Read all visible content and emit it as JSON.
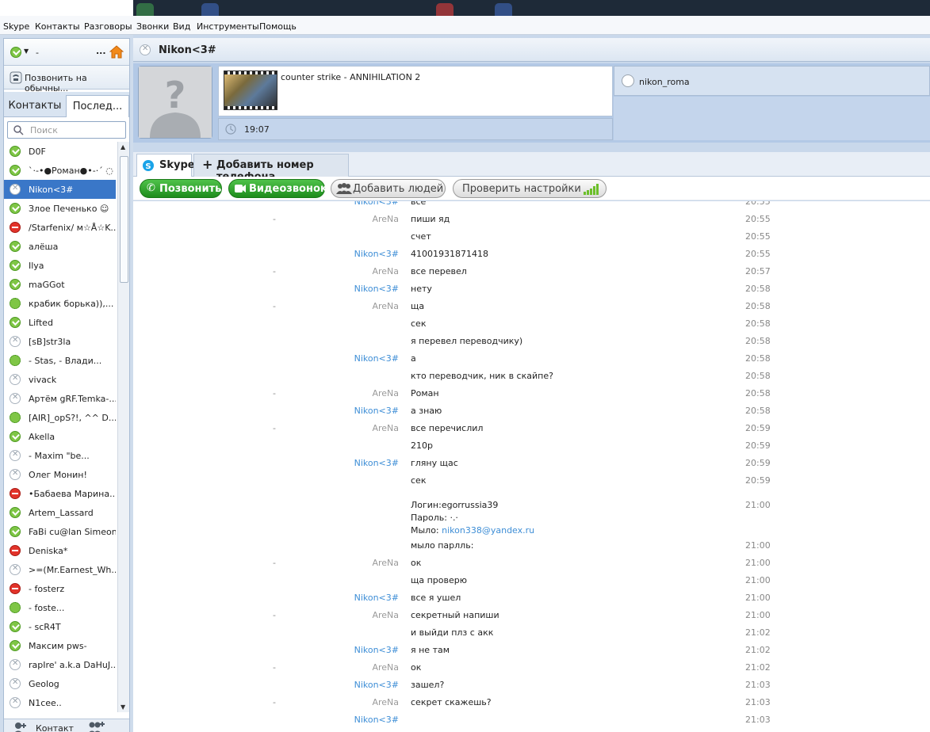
{
  "menu": [
    "Skype",
    "Контакты",
    "Разговоры",
    "Звонки",
    "Вид",
    "Инструменты",
    "Помощь"
  ],
  "left": {
    "status_dash": "-",
    "call_phones": "Позвонить на обычны...",
    "tabs": [
      "Контакты",
      "Послед..."
    ],
    "search_placeholder": "Поиск",
    "contacts": [
      {
        "name": "D0F",
        "status": "online"
      },
      {
        "name": "`·-•●Роман●•-·´ ◌",
        "status": "online"
      },
      {
        "name": "Nikon<3#",
        "status": "offline",
        "selected": true
      },
      {
        "name": "Злое Печенько ☺",
        "status": "online"
      },
      {
        "name": "/Starfenix/ м☆Å☆K...",
        "status": "dnd"
      },
      {
        "name": "алёша",
        "status": "online"
      },
      {
        "name": "Ilya",
        "status": "online"
      },
      {
        "name": "maGGot",
        "status": "online"
      },
      {
        "name": "крабик борька)),...",
        "status": "pending"
      },
      {
        "name": "Lifted",
        "status": "online"
      },
      {
        "name": "[sB]str3la",
        "status": "offline"
      },
      {
        "name": "- Stas, -      Влади...",
        "status": "pending"
      },
      {
        "name": "vivack",
        "status": "offline"
      },
      {
        "name": "Артём gRF.Temka-...",
        "status": "offline"
      },
      {
        "name": "[AIR]_opS?!, ^^ D...",
        "status": "pending"
      },
      {
        "name": "Akella",
        "status": "online"
      },
      {
        "name": "-          Maxim \"be...",
        "status": "offline"
      },
      {
        "name": " Олег Монин!",
        "status": "offline"
      },
      {
        "name": "•Бабаева Марина...",
        "status": "dnd"
      },
      {
        "name": "Artem_Lassard",
        "status": "online"
      },
      {
        "name": "FaBi cu@lan Simeon...",
        "status": "online"
      },
      {
        "name": "Deniska*",
        "status": "dnd"
      },
      {
        "name": ">=(Mr.Earnest_Wh...",
        "status": "offline"
      },
      {
        "name": "-                fosterz",
        "status": "dnd"
      },
      {
        "name": "-                foste...",
        "status": "pending"
      },
      {
        "name": "-   scR4T",
        "status": "online"
      },
      {
        "name": "Максим pws-",
        "status": "online"
      },
      {
        "name": "rapIre' a.k.a DaHuJ...",
        "status": "offline"
      },
      {
        "name": "Geolog",
        "status": "offline"
      },
      {
        "name": "N1cee..",
        "status": "offline"
      }
    ],
    "bottom_label": "Контакт"
  },
  "conv": {
    "title": "Nikon<3#",
    "mood": "counter strike - ANNIHILATION 2",
    "local_time": "19:07",
    "skype_name": "nikon_roma",
    "tabs": [
      "Skype",
      "Добавить номер телефона"
    ],
    "buttons": {
      "call": "Позвонить",
      "video": "Видеозвонок",
      "add": "Добавить людей",
      "check": "Проверить настройки"
    },
    "messages": [
      {
        "dash": "",
        "author": "Nikon<3#",
        "who": "nk",
        "text": "все",
        "time": "20:55"
      },
      {
        "dash": "-",
        "author": "AreNa",
        "who": "ar",
        "text": "пиши яд",
        "time": "20:55"
      },
      {
        "dash": "",
        "author": "",
        "who": "",
        "text": "счет",
        "time": "20:55"
      },
      {
        "dash": "",
        "author": "Nikon<3#",
        "who": "nk",
        "text": "41001931871418",
        "time": "20:55"
      },
      {
        "dash": "-",
        "author": "AreNa",
        "who": "ar",
        "text": "все перевел",
        "time": "20:57"
      },
      {
        "dash": "",
        "author": "Nikon<3#",
        "who": "nk",
        "text": "нету",
        "time": "20:58"
      },
      {
        "dash": "-",
        "author": "AreNa",
        "who": "ar",
        "text": "ща",
        "time": "20:58"
      },
      {
        "dash": "",
        "author": "",
        "who": "",
        "text": "сек",
        "time": "20:58"
      },
      {
        "dash": "",
        "author": "",
        "who": "",
        "text": "я перевел переводчику)",
        "time": "20:58"
      },
      {
        "dash": "",
        "author": "Nikon<3#",
        "who": "nk",
        "text": "а",
        "time": "20:58"
      },
      {
        "dash": "",
        "author": "",
        "who": "",
        "text": "кто переводчик, ник в скайпе?",
        "time": "20:58"
      },
      {
        "dash": "-",
        "author": "AreNa",
        "who": "ar",
        "text": "Роман",
        "time": "20:58"
      },
      {
        "dash": "",
        "author": "Nikon<3#",
        "who": "nk",
        "text": "а знаю",
        "time": "20:58"
      },
      {
        "dash": "-",
        "author": "AreNa",
        "who": "ar",
        "text": "все перечислил",
        "time": "20:59"
      },
      {
        "dash": "",
        "author": "",
        "who": "",
        "text": "210р",
        "time": "20:59"
      },
      {
        "dash": "",
        "author": "Nikon<3#",
        "who": "nk",
        "text": "гляну щас",
        "time": "20:59"
      },
      {
        "dash": "",
        "author": "",
        "who": "",
        "text": "сек",
        "time": "20:59"
      }
    ],
    "login_block": {
      "l1": "Логин:egorrussia39",
      "l2": "Пароль: ·.·",
      "l3_label": "Мыло: ",
      "l3_link": "nikon338@yandex.ru",
      "time": "21:00"
    },
    "messages2": [
      {
        "dash": "",
        "author": "",
        "who": "",
        "text": "мыло парлль:",
        "time": "21:00"
      },
      {
        "dash": "-",
        "author": "AreNa",
        "who": "ar",
        "text": "ок",
        "time": "21:00"
      },
      {
        "dash": "",
        "author": "",
        "who": "",
        "text": "ща проверю",
        "time": "21:00"
      },
      {
        "dash": "",
        "author": "Nikon<3#",
        "who": "nk",
        "text": "все я ушел",
        "time": "21:00"
      },
      {
        "dash": "-",
        "author": "AreNa",
        "who": "ar",
        "text": "секретный напиши",
        "time": "21:00"
      },
      {
        "dash": "",
        "author": "",
        "who": "",
        "text": "и выйди плз с акк",
        "time": "21:02"
      },
      {
        "dash": "",
        "author": "Nikon<3#",
        "who": "nk",
        "text": "я не там",
        "time": "21:02"
      },
      {
        "dash": "-",
        "author": "AreNa",
        "who": "ar",
        "text": "ок",
        "time": "21:02"
      },
      {
        "dash": "",
        "author": "Nikon<3#",
        "who": "nk",
        "text": "зашел?",
        "time": "21:03"
      },
      {
        "dash": "-",
        "author": "AreNa",
        "who": "ar",
        "text": "секрет скажешь?",
        "time": "21:03"
      },
      {
        "dash": "",
        "author": "Nikon<3#",
        "who": "nk",
        "text": "",
        "time": "21:03"
      }
    ]
  }
}
